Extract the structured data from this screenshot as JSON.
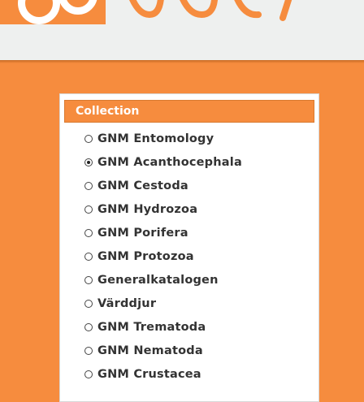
{
  "colors": {
    "accent": "#f68c3e",
    "header_bg": "#eef0ef",
    "card_bg": "#ffffff",
    "text": "#333333"
  },
  "collection": {
    "title": "Collection",
    "selected_index": 1,
    "options": [
      {
        "label": "GNM Entomology",
        "checked": false
      },
      {
        "label": "GNM Acanthocephala",
        "checked": true
      },
      {
        "label": "GNM Cestoda",
        "checked": false
      },
      {
        "label": "GNM Hydrozoa",
        "checked": false
      },
      {
        "label": "GNM Porifera",
        "checked": false
      },
      {
        "label": "GNM Protozoa",
        "checked": false
      },
      {
        "label": "Generalkatalogen",
        "checked": false
      },
      {
        "label": "Värddjur",
        "checked": false
      },
      {
        "label": "GNM Trematoda",
        "checked": false
      },
      {
        "label": "GNM Nematoda",
        "checked": false
      },
      {
        "label": "GNM Crustacea",
        "checked": false
      }
    ]
  }
}
